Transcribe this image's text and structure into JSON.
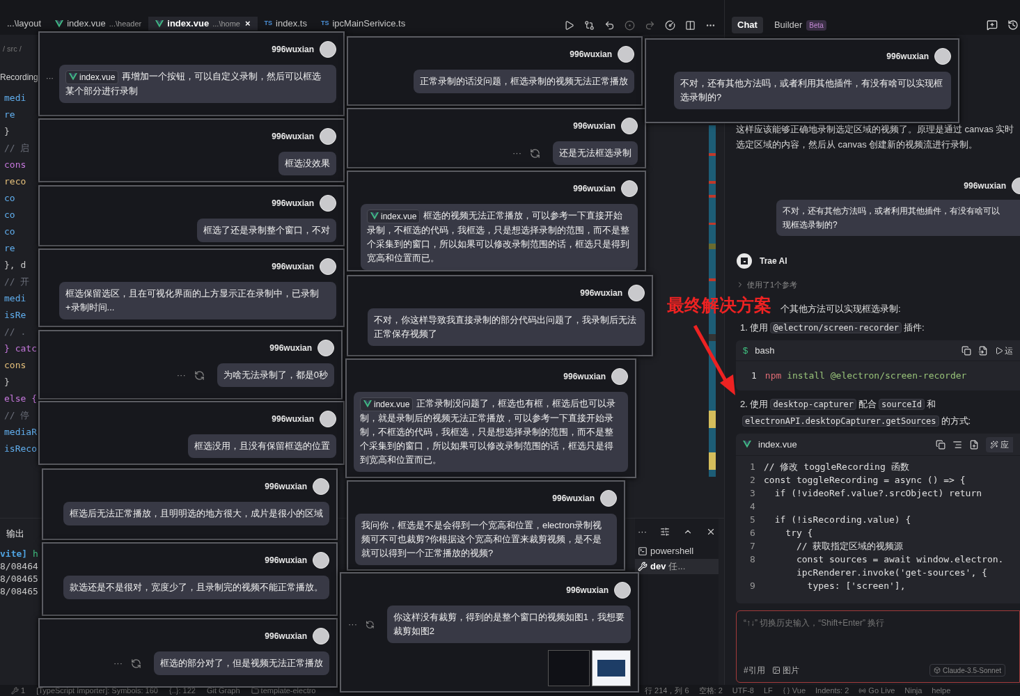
{
  "editor_tabs": [
    {
      "label": "...\\layout",
      "kind": "plain",
      "selected": false
    },
    {
      "label": "index.vue",
      "path": "...\\header",
      "kind": "vue",
      "selected": false
    },
    {
      "label": "index.vue",
      "path": "...\\home",
      "kind": "vue",
      "selected": true,
      "close": "×"
    },
    {
      "label": "index.ts",
      "kind": "ts",
      "badge": "TS",
      "selected": false
    },
    {
      "label": "ipcMainSerivice.ts",
      "kind": "ts",
      "badge": "TS",
      "selected": false
    }
  ],
  "panel_tabs": [
    {
      "label": "Chat",
      "selected": true
    },
    {
      "label": "Builder",
      "badge": "Beta",
      "selected": false
    }
  ],
  "breadcrumb": "/ src /",
  "outline": {
    "label": "Recording",
    "more": "···"
  },
  "code_fragments": [
    {
      "text": "medi",
      "kind": "ident"
    },
    {
      "text": "re",
      "kind": "ident"
    },
    {
      "text": "}",
      "kind": "plain"
    },
    {
      "text": "// 启",
      "kind": "comment"
    },
    {
      "text": "cons",
      "kind": "keyword"
    },
    {
      "text": "reco",
      "kind": "func"
    },
    {
      "text": "co",
      "kind": "ident"
    },
    {
      "text": "co",
      "kind": "ident"
    },
    {
      "text": "co",
      "kind": "ident"
    },
    {
      "text": "re",
      "kind": "ident"
    },
    {
      "text": "}, d",
      "kind": "plain"
    },
    {
      "text": "// 开",
      "kind": "comment"
    },
    {
      "text": "medi",
      "kind": "ident"
    },
    {
      "text": "isRe",
      "kind": "ident"
    },
    {
      "text": "// .",
      "kind": "comment"
    },
    {
      "text": "} catc",
      "kind": "keyword"
    },
    {
      "text": "cons",
      "kind": "func"
    },
    {
      "text": "}",
      "kind": "plain"
    },
    {
      "text": "else {",
      "kind": "keyword"
    },
    {
      "text": "// 停",
      "kind": "comment"
    },
    {
      "text": "mediaR",
      "kind": "ident"
    },
    {
      "text": "isReco",
      "kind": "ident"
    }
  ],
  "output": {
    "title": "输出",
    "lines": [
      {
        "kind": "tagged",
        "tag": "vite]",
        "text": "h"
      },
      {
        "kind": "plain",
        "text": "8/08464"
      },
      {
        "kind": "plain",
        "text": "8/08465"
      },
      {
        "kind": "plain",
        "text": "8/08465"
      }
    ]
  },
  "terminal": {
    "more": "···",
    "items": [
      {
        "kind": "shell",
        "label": "powershell",
        "selected": false
      },
      {
        "kind": "task",
        "label": "dev",
        "detail": "任...",
        "selected": true
      }
    ]
  },
  "chat": {
    "ai_text_lines": [
      "这样应该能够正确地录制选定区域的视频了。原理是通过 canvas 实时",
      "选定区域的内容，然后从 canvas 创建新的视频流进行录制。"
    ],
    "user_name": "996wuxian",
    "user_bubble_lines": [
      "不对，还有其他方法吗，或者利用其他插件，有没有啥可以",
      "现框选录制的?"
    ],
    "assistant": "Trae AI",
    "references": "使用了1个参考",
    "intro": "个其他方法可以实现框选录制:",
    "steps": [
      {
        "number": "1.",
        "parts": [
          {
            "kind": "text",
            "text": "使用"
          },
          {
            "kind": "code",
            "text": "@electron/screen-recorder"
          },
          {
            "kind": "text",
            "text": "插件:"
          }
        ]
      },
      {
        "number": "2.",
        "parts": [
          {
            "kind": "text",
            "text": "使用"
          },
          {
            "kind": "code",
            "text": "desktop-capturer"
          },
          {
            "kind": "text",
            "text": "配合"
          },
          {
            "kind": "code",
            "text": "sourceId"
          },
          {
            "kind": "text",
            "text": "和"
          },
          {
            "kind": "code",
            "text": "electronAPI.desktopCapturer.getSources"
          },
          {
            "kind": "text",
            "text": "的方式:"
          }
        ]
      }
    ],
    "bash_block": {
      "prompt": "$",
      "language": "bash",
      "action": "运",
      "lines": [
        {
          "number": "1",
          "command": "npm",
          "text": "install @electron/screen-recorder"
        }
      ]
    },
    "vue_block": {
      "file": "index.vue",
      "action": "应",
      "lines": [
        {
          "number": "1",
          "text": "// 修改 toggleRecording 函数"
        },
        {
          "number": "2",
          "text": "const toggleRecording = async () => {"
        },
        {
          "number": "3",
          "text": "  if (!videoRef.value?.srcObject) return"
        },
        {
          "number": "4"
        },
        {
          "number": "5",
          "text": "  if (!isRecording.value) {"
        },
        {
          "number": "6",
          "text": "    try {"
        },
        {
          "number": "7",
          "text": "      // 获取指定区域的视频源"
        },
        {
          "number": "8",
          "text": "      const sources = await window.electron.",
          "continuation": "      ipcRenderer.invoke('get-sources', {"
        },
        {
          "number": "9",
          "text": "        types: ['screen'],"
        }
      ]
    },
    "input": {
      "placeholder": "“↑↓” 切换历史输入，“Shift+Enter” 换行",
      "quote": "#引用",
      "image": "图片",
      "model": "Claude-3.5-Sonnet"
    }
  },
  "annotation": {
    "text": "最终解决方案"
  },
  "cards": [
    {
      "user": "996wuxian",
      "attachment": "index.vue",
      "text": "再增加一个按钮，可以自定义录制，然后可以框选某个部分进行录制"
    },
    {
      "user": "996wuxian",
      "text": "框选没效果"
    },
    {
      "user": "996wuxian",
      "text": "框选了还是录制整个窗口，不对"
    },
    {
      "user": "996wuxian",
      "text": "框选保留选区，且在可视化界面的上方显示正在录制中，已录制+录制时间..."
    },
    {
      "user": "996wuxian",
      "text": "为啥无法录制了，都是0秒",
      "more": "···"
    },
    {
      "user": "996wuxian",
      "text": "框选没用，且没有保留框选的位置"
    },
    {
      "user": "996wuxian",
      "text": "框选后无法正常播放，且明明选的地方很大，成片是很小的区域"
    },
    {
      "user": "996wuxian",
      "text": "款选还是不是很对，宽度少了，且录制完的视频不能正常播放。"
    },
    {
      "user": "996wuxian",
      "text": "框选的部分对了，但是视频无法正常播放",
      "more": "···"
    },
    {
      "user": "996wuxian",
      "text": "正常录制的话没问题，框选录制的视频无法正常播放"
    },
    {
      "user": "996wuxian",
      "text": "还是无法框选录制",
      "more": "···"
    },
    {
      "user": "996wuxian",
      "attachment": "index.vue",
      "text": "框选的视频无法正常播放，可以参考一下直接开始录制，不框选的代码，我框选，只是想选择录制的范围，而不是整个采集到的窗口，所以如果可以修改录制范围的话，框选只是得到宽高和位置而已。"
    },
    {
      "user": "996wuxian",
      "text": "不对，你这样导致我直接录制的部分代码出问题了，我录制后无法正常保存视频了"
    },
    {
      "user": "996wuxian",
      "attachment": "index.vue",
      "text": "正常录制没问题了，框选也有框，框选后也可以录制，就是录制后的视频无法正常播放，可以参考一下直接开始录制，不框选的代码，我框选，只是想选择录制的范围，而不是整个采集到的窗口，所以如果可以修改录制范围的话，框选只是得到宽高和位置而已。"
    },
    {
      "user": "996wuxian",
      "text": "我问你，框选是不是会得到一个宽高和位置，electron录制视频可不可也裁剪?你根据这个宽高和位置来裁剪视频，是不是就可以得到一个正常播放的视频?"
    },
    {
      "user": "996wuxian",
      "text": "你这样没有裁剪，得到的是整个窗口的视频如图1，我想要裁剪如图2",
      "more": "···",
      "images": [
        {
          "kind": "dark"
        },
        {
          "kind": "light"
        }
      ]
    },
    {
      "user": "996wuxian",
      "text": "不对，还有其他方法吗，或者利用其他插件，有没有啥可以实现框选录制的?"
    }
  ],
  "status_bar": {
    "left": [
      {
        "kind": "tools",
        "text": "1"
      },
      {
        "kind": "plain",
        "text": "[TypeScript Importer]: Symbols: 160"
      },
      {
        "kind": "plain",
        "text": "{..}: 122"
      },
      {
        "kind": "plain",
        "text": "Git Graph"
      },
      {
        "kind": "folder",
        "text": "template-electro"
      }
    ],
    "right": [
      {
        "kind": "plain",
        "text": "行 214，列 6"
      },
      {
        "kind": "plain",
        "text": "空格: 2"
      },
      {
        "kind": "plain",
        "text": "UTF-8"
      },
      {
        "kind": "plain",
        "text": "LF"
      },
      {
        "kind": "braces",
        "text": "Vue"
      },
      {
        "kind": "plain",
        "text": "Indents: 2"
      },
      {
        "kind": "live",
        "text": "Go Live"
      },
      {
        "kind": "plain",
        "text": "Ninja"
      },
      {
        "kind": "plain",
        "text": "helpe"
      }
    ]
  }
}
